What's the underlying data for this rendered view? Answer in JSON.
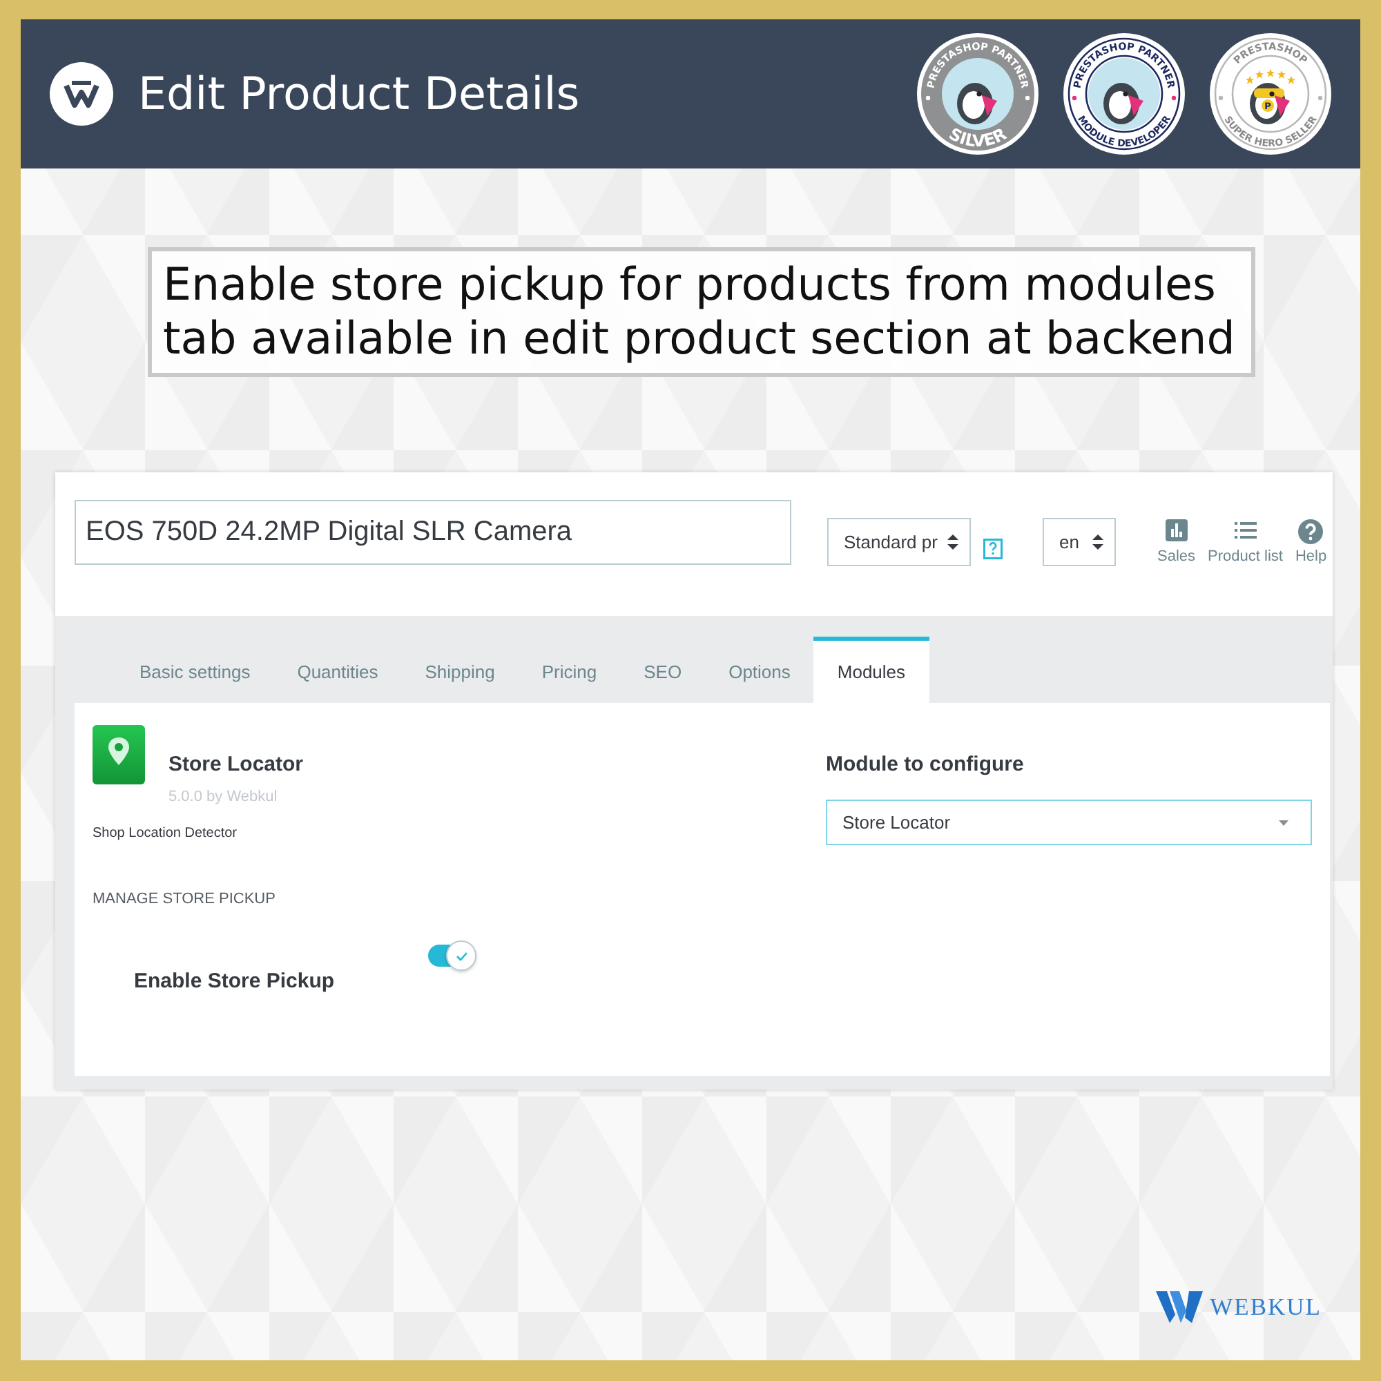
{
  "header": {
    "title": "Edit Product Details",
    "badges": [
      {
        "kind": "silver",
        "top": "PRESTASHOP PARTNER",
        "bottom": "SILVER"
      },
      {
        "kind": "developer",
        "top": "PRESTASHOP PARTNER",
        "bottom": "MODULE DEVELOPER"
      },
      {
        "kind": "superhero",
        "top": "PRESTASHOP",
        "bottom": "SUPER HERO SELLER",
        "emblem": "P"
      }
    ]
  },
  "caption": "Enable store pickup for products from modules tab available in edit product section at backend",
  "product_page": {
    "product_name": "EOS 750D 24.2MP Digital SLR Camera",
    "product_type": "Standard pr",
    "language": "en",
    "toolbar": [
      {
        "kind": "sales",
        "label": "Sales"
      },
      {
        "kind": "list",
        "label": "Product list"
      },
      {
        "kind": "help",
        "label": "Help"
      }
    ],
    "tabs": [
      {
        "label": "Basic settings",
        "selected": false
      },
      {
        "label": "Quantities",
        "selected": false
      },
      {
        "label": "Shipping",
        "selected": false
      },
      {
        "label": "Pricing",
        "selected": false
      },
      {
        "label": "SEO",
        "selected": false
      },
      {
        "label": "Options",
        "selected": false
      },
      {
        "label": "Modules",
        "selected": true
      }
    ],
    "module": {
      "name": "Store Locator",
      "version": "5.0.0 by Webkul",
      "description": "Shop Location Detector"
    },
    "section_title": "MANAGE STORE PICKUP",
    "settings": [
      {
        "label": "Enable Store Pickup",
        "on": true
      }
    ],
    "configure": {
      "label": "Module to configure",
      "value": "Store Locator"
    }
  },
  "brand": {
    "name": "WEBKUL"
  }
}
